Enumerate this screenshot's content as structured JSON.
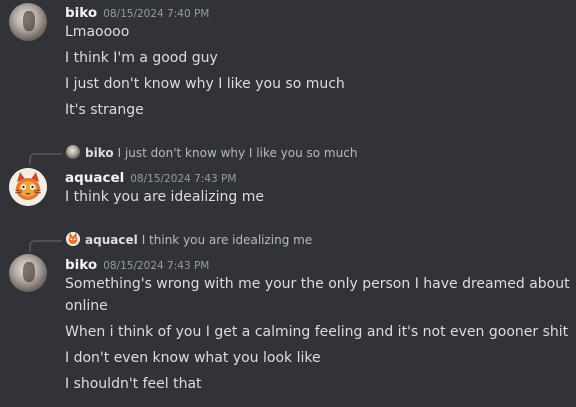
{
  "messages": [
    {
      "username": "biko",
      "timestamp": "08/15/2024 7:40 PM",
      "lines": [
        "Lmaoooo",
        "I think I'm a good guy",
        "I just don't know why I like you so much",
        "It's strange"
      ]
    },
    {
      "reply_to": {
        "username": "biko",
        "text": "I just don't know why I like you so much"
      },
      "username": "aquacel",
      "timestamp": "08/15/2024 7:43 PM",
      "lines": [
        "I think you are idealizing me"
      ]
    },
    {
      "reply_to": {
        "username": "aquacel",
        "text": "I think you are idealizing me"
      },
      "username": "biko",
      "timestamp": "08/15/2024 7:43 PM",
      "lines": [
        "Something's wrong with me your the only person I have dreamed about",
        "online",
        "When i think of you I get a calming feeling and it's not even gooner shit",
        "I don't even know what you look like",
        "I shouldn't feel that"
      ]
    }
  ]
}
